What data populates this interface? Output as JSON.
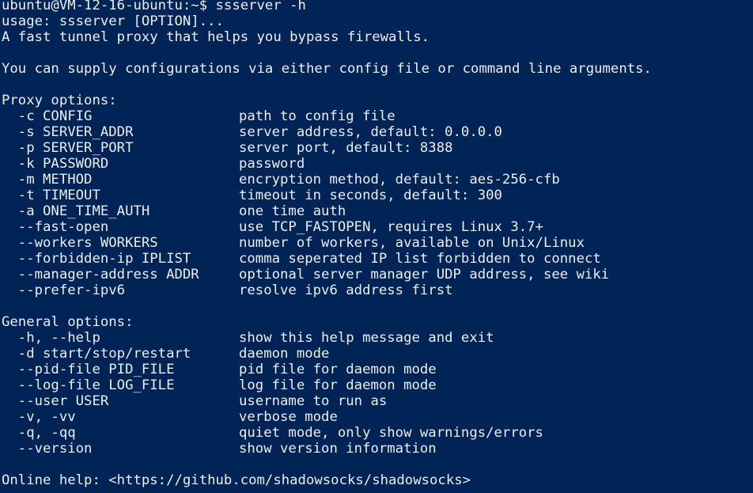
{
  "prompt": "ubuntu@VM-12-16-ubuntu:~$ ssserver -h",
  "usage": "usage: ssserver [OPTION]...",
  "tagline": "A fast tunnel proxy that helps you bypass firewalls.",
  "config_note": "You can supply configurations via either config file or command line arguments.",
  "proxy": {
    "heading": "Proxy options:",
    "options": [
      {
        "flag": "  -c CONFIG",
        "desc": "path to config file"
      },
      {
        "flag": "  -s SERVER_ADDR",
        "desc": "server address, default: 0.0.0.0"
      },
      {
        "flag": "  -p SERVER_PORT",
        "desc": "server port, default: 8388"
      },
      {
        "flag": "  -k PASSWORD",
        "desc": "password"
      },
      {
        "flag": "  -m METHOD",
        "desc": "encryption method, default: aes-256-cfb"
      },
      {
        "flag": "  -t TIMEOUT",
        "desc": "timeout in seconds, default: 300"
      },
      {
        "flag": "  -a ONE_TIME_AUTH",
        "desc": "one time auth"
      },
      {
        "flag": "  --fast-open",
        "desc": "use TCP_FASTOPEN, requires Linux 3.7+"
      },
      {
        "flag": "  --workers WORKERS",
        "desc": "number of workers, available on Unix/Linux"
      },
      {
        "flag": "  --forbidden-ip IPLIST",
        "desc": "comma seperated IP list forbidden to connect"
      },
      {
        "flag": "  --manager-address ADDR",
        "desc": "optional server manager UDP address, see wiki"
      },
      {
        "flag": "  --prefer-ipv6",
        "desc": "resolve ipv6 address first"
      }
    ]
  },
  "general": {
    "heading": "General options:",
    "options": [
      {
        "flag": "  -h, --help",
        "desc": "show this help message and exit"
      },
      {
        "flag": "  -d start/stop/restart",
        "desc": "daemon mode"
      },
      {
        "flag": "  --pid-file PID_FILE",
        "desc": "pid file for daemon mode"
      },
      {
        "flag": "  --log-file LOG_FILE",
        "desc": "log file for daemon mode"
      },
      {
        "flag": "  --user USER",
        "desc": "username to run as"
      },
      {
        "flag": "  -v, -vv",
        "desc": "verbose mode"
      },
      {
        "flag": "  -q, -qq",
        "desc": "quiet mode, only show warnings/errors"
      },
      {
        "flag": "  --version",
        "desc": "show version information"
      }
    ]
  },
  "online_help": "Online help: <https://github.com/shadowsocks/shadowsocks>",
  "colors": {
    "background": "#012456",
    "foreground": "#eeedf0"
  }
}
